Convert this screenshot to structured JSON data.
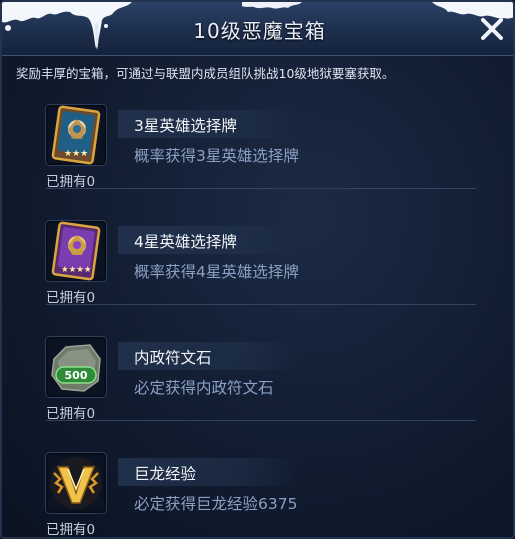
{
  "header": {
    "title": "10级恶魔宝箱"
  },
  "description": "奖励丰厚的宝箱，可通过与联盟内成员组队挑战10级地狱要塞获取。",
  "items": [
    {
      "icon": "hero-card-3star-icon",
      "name": "3星英雄选择牌",
      "subtext": "概率获得3星英雄选择牌",
      "owned": "已拥有0"
    },
    {
      "icon": "hero-card-4star-icon",
      "name": "4星英雄选择牌",
      "subtext": "概率获得4星英雄选择牌",
      "owned": "已拥有0"
    },
    {
      "icon": "politics-rune-stone-icon",
      "badge": "500",
      "name": "内政符文石",
      "subtext": "必定获得内政符文石",
      "owned": "已拥有0"
    },
    {
      "icon": "dragon-experience-icon",
      "name": "巨龙经验",
      "subtext": "必定获得巨龙经验6375",
      "owned": "已拥有0"
    }
  ],
  "colors": {
    "panel_bg": "#111c30",
    "header_bg": "#2b4166",
    "title_text": "#e9eef8",
    "subtext": "#8aa0c2",
    "gold": "#d9a441",
    "purple": "#7a3db0"
  }
}
